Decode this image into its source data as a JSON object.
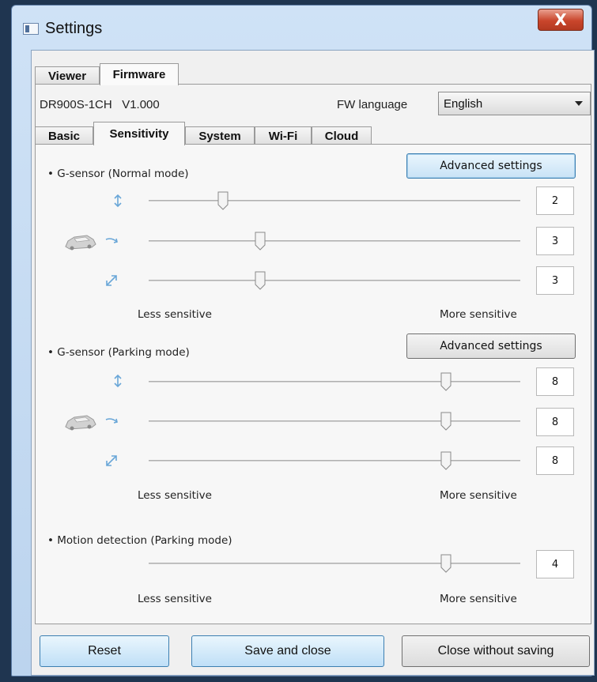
{
  "window": {
    "title": "Settings",
    "close_symbol": "X"
  },
  "top_tabs": [
    "Viewer",
    "Firmware"
  ],
  "firmware": {
    "model_version": "DR900S-1CH   V1.000",
    "language_label": "FW language",
    "language_value": "English"
  },
  "sub_tabs": [
    "Basic",
    "Sensitivity",
    "System",
    "Wi-Fi",
    "Cloud"
  ],
  "normal_mode": {
    "title": "• G-sensor (Normal mode)",
    "advanced_label": "Advanced settings",
    "axes": [
      {
        "icon": "vertical-axis-icon",
        "value": "2",
        "level": 2
      },
      {
        "icon": "lateral-axis-icon",
        "value": "3",
        "level": 3
      },
      {
        "icon": "diagonal-axis-icon",
        "value": "3",
        "level": 3
      }
    ]
  },
  "parking_mode": {
    "title": "• G-sensor (Parking mode)",
    "advanced_label": "Advanced settings",
    "axes": [
      {
        "icon": "vertical-axis-icon",
        "value": "8",
        "level": 8
      },
      {
        "icon": "lateral-axis-icon",
        "value": "8",
        "level": 8
      },
      {
        "icon": "diagonal-axis-icon",
        "value": "8",
        "level": 8
      }
    ]
  },
  "motion_detection": {
    "title": "• Motion detection (Parking mode)",
    "value": "4",
    "level": 8
  },
  "scale": {
    "less": "Less sensitive",
    "more": "More sensitive",
    "max_level": 10
  },
  "buttons": {
    "reset": "Reset",
    "save": "Save and close",
    "close": "Close without saving"
  },
  "colors": {
    "icon_blue": "#6aa7d8",
    "accent_border": "#3c7fb1"
  }
}
